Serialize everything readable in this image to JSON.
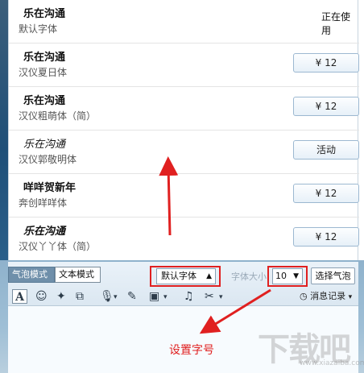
{
  "font_list": [
    {
      "preview": "乐在沟通",
      "name": "默认字体",
      "status": "正在使用"
    },
    {
      "preview": "乐在沟通",
      "name": "汉仪夏日体",
      "price": "¥ 12"
    },
    {
      "preview": "乐在沟通",
      "name": "汉仪粗萌体（简）",
      "price": "¥ 12"
    },
    {
      "preview": "乐在沟通",
      "name": "汉仪郭敬明体",
      "action": "活动"
    },
    {
      "preview": "咩咩贺新年",
      "name": "奔创咩咩体",
      "price": "¥ 12"
    },
    {
      "preview": "乐在沟通",
      "name": "汉仪丫丫体（简）",
      "price": "¥ 12"
    }
  ],
  "toolbar": {
    "mode_bubble": "气泡模式",
    "mode_text": "文本模式",
    "font_value": "默认字体",
    "size_label": "字体大小",
    "size_value": "10",
    "bubble_button": "选择气泡",
    "history": "消息记录",
    "font_style_icon": "A"
  },
  "annotation": {
    "label": "设置字号"
  },
  "watermark": {
    "text": "下载吧",
    "sub": "www.xiazaiba.com"
  },
  "colors": {
    "annotation_red": "#e02020",
    "toolbar_bg": "#dbe7f1",
    "active_tab": "#6f8faa"
  }
}
